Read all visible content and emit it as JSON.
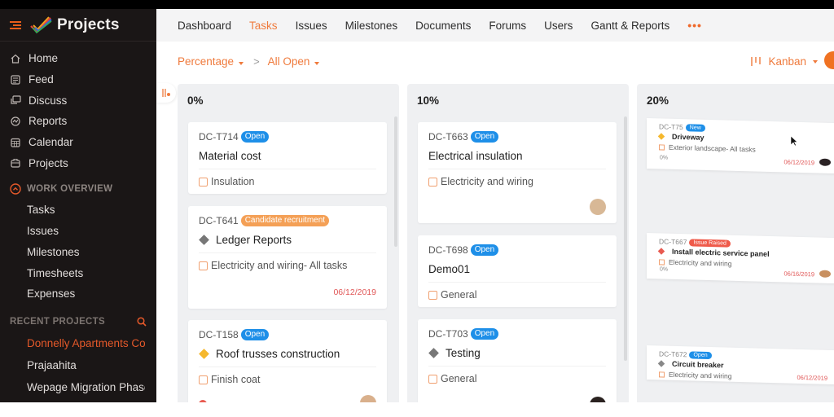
{
  "app": {
    "title": "Projects"
  },
  "sidebar": {
    "nav": [
      {
        "label": "Home",
        "icon": "home-icon"
      },
      {
        "label": "Feed",
        "icon": "feed-icon"
      },
      {
        "label": "Discuss",
        "icon": "discuss-icon"
      },
      {
        "label": "Reports",
        "icon": "reports-icon"
      },
      {
        "label": "Calendar",
        "icon": "calendar-icon"
      },
      {
        "label": "Projects",
        "icon": "projects-icon"
      }
    ],
    "work_overview": {
      "label": "WORK OVERVIEW",
      "items": [
        "Tasks",
        "Issues",
        "Milestones",
        "Timesheets",
        "Expenses"
      ]
    },
    "recent_projects": {
      "label": "RECENT PROJECTS",
      "items": [
        "Donnelly Apartments Co",
        "Prajaahita",
        "Wepage Migration Phase"
      ]
    }
  },
  "topnav": {
    "tabs": [
      "Dashboard",
      "Tasks",
      "Issues",
      "Milestones",
      "Documents",
      "Forums",
      "Users",
      "Gantt & Reports"
    ],
    "active": "Tasks",
    "more": "•••"
  },
  "toolbar": {
    "group_by": "Percentage",
    "filter": "All Open",
    "view": "Kanban"
  },
  "colors": {
    "accent": "#ef7a3c",
    "sidebar_bg": "#1a1616",
    "open_badge": "#1e8fe8"
  },
  "board": {
    "columns": [
      {
        "title": "0%",
        "cards": [
          {
            "id": "DC-T714",
            "badge": "Open",
            "title": "Material cost",
            "list": "Insulation",
            "date": ""
          },
          {
            "id": "DC-T641",
            "badge": "Candidate recruitment",
            "title": "Ledger Reports",
            "list": "Electricity and wiring- All tasks",
            "date": "06/12/2019"
          },
          {
            "id": "DC-T158",
            "badge": "Open",
            "title": "Roof trusses construction",
            "list": "Finish coat",
            "date": ""
          }
        ]
      },
      {
        "title": "10%",
        "cards": [
          {
            "id": "DC-T663",
            "badge": "Open",
            "title": "Electrical insulation",
            "list": "Electricity and wiring",
            "date": ""
          },
          {
            "id": "DC-T698",
            "badge": "Open",
            "title": "Demo01",
            "list": "General",
            "date": ""
          },
          {
            "id": "DC-T703",
            "badge": "Open",
            "title": "Testing",
            "list": "General",
            "date": ""
          }
        ]
      },
      {
        "title": "20%",
        "cards": [
          {
            "id": "DC-T75",
            "badge": "New",
            "title": "Driveway",
            "list": "Exterior landscape- All tasks",
            "sub": "0%",
            "date": "06/12/2019"
          },
          {
            "id": "DC-T667",
            "badge": "Issue Raised",
            "title": "Install electric service panel",
            "list": "Electricity and wiring",
            "sub": "0%",
            "date": "06/16/2019"
          },
          {
            "id": "DC-T672",
            "badge": "Open",
            "title": "Circuit breaker",
            "list": "Electricity and wiring",
            "sub": "",
            "date": "06/12/2019"
          }
        ]
      }
    ]
  }
}
